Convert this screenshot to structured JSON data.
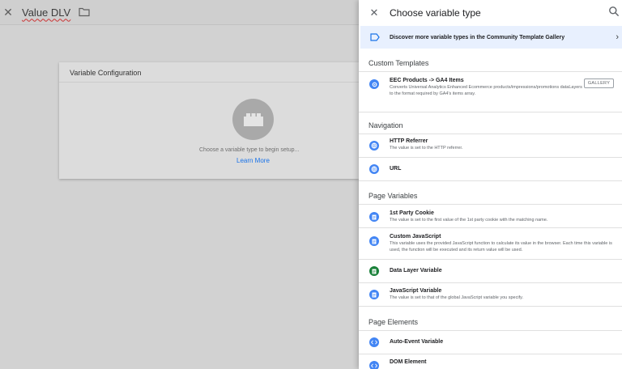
{
  "background": {
    "header_title": "Value DLV",
    "card_title": "Variable Configuration",
    "placeholder_text": "Choose a variable type to begin setup...",
    "learn_more": "Learn More"
  },
  "panel": {
    "title": "Choose variable type",
    "banner": "Discover more variable types in the Community Template Gallery",
    "sections": {
      "custom_templates": "Custom Templates",
      "navigation": "Navigation",
      "page_variables": "Page Variables",
      "page_elements": "Page Elements"
    },
    "items": {
      "eec": {
        "title": "EEC Products -> GA4 Items",
        "desc": "Converts Universal Analytics Enhanced Ecommerce products/impressions/promotions dataLayers to the format required by GA4's items array.",
        "button": "GALLERY"
      },
      "http_referrer": {
        "title": "HTTP Referrer",
        "desc": "The value is set to the HTTP referrer."
      },
      "url": {
        "title": "URL"
      },
      "first_party_cookie": {
        "title": "1st Party Cookie",
        "desc": "The value is set to the first value of the 1st party cookie with the matching name."
      },
      "custom_js": {
        "title": "Custom JavaScript",
        "desc": "This variable uses the provided JavaScript function to calculate its value in the browser. Each time this variable is used, the function will be executed and its return value will be used."
      },
      "data_layer": {
        "title": "Data Layer Variable"
      },
      "js_variable": {
        "title": "JavaScript Variable",
        "desc": "The value is set to that of the global JavaScript variable you specify."
      },
      "auto_event": {
        "title": "Auto-Event Variable"
      },
      "dom_element": {
        "title": "DOM Element"
      }
    }
  },
  "colors": {
    "accent": "#4285f4",
    "data_layer_icon": "#188038",
    "highlight": "#ffff00",
    "banner_bg": "#e8f0fe",
    "link": "#1a73e8"
  }
}
